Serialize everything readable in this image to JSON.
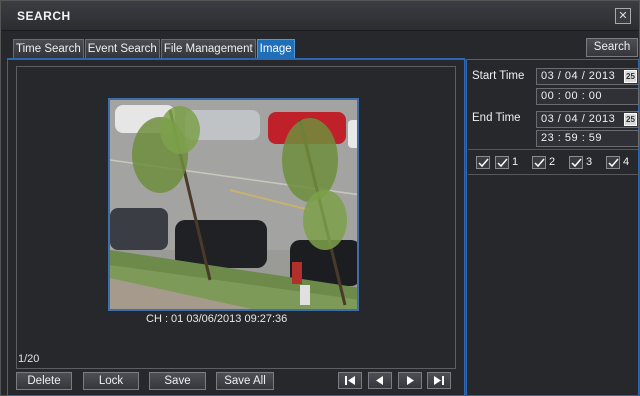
{
  "window": {
    "title": "SEARCH"
  },
  "tabs": [
    {
      "label": "Time Search",
      "active": false
    },
    {
      "label": "Event Search",
      "active": false
    },
    {
      "label": "File Management",
      "active": false
    },
    {
      "label": "Image",
      "active": true
    }
  ],
  "toolbar": {
    "search_label": "Search"
  },
  "viewer": {
    "caption": "CH : 01  03/06/2013 09:27:36",
    "page_counter": "1/20"
  },
  "actions": {
    "delete_label": "Delete",
    "lock_label": "Lock",
    "save_label": "Save",
    "save_all_label": "Save All"
  },
  "filter": {
    "start_time_label": "Start Time",
    "start_date": "03 / 04 / 2013",
    "start_time": "00  :  00  :  00",
    "end_time_label": "End Time",
    "end_date": "03 / 04 / 2013",
    "end_time": "23  :  59  :  59",
    "calendar_badge": "25"
  },
  "channels": [
    {
      "label": "",
      "checked": true
    },
    {
      "label": "1",
      "checked": true
    },
    {
      "label": "2",
      "checked": true
    },
    {
      "label": "3",
      "checked": true
    },
    {
      "label": "4",
      "checked": true
    }
  ],
  "colors": {
    "accent": "#1e6fb8",
    "frame": "#2e67b0",
    "background": "#26282c"
  }
}
